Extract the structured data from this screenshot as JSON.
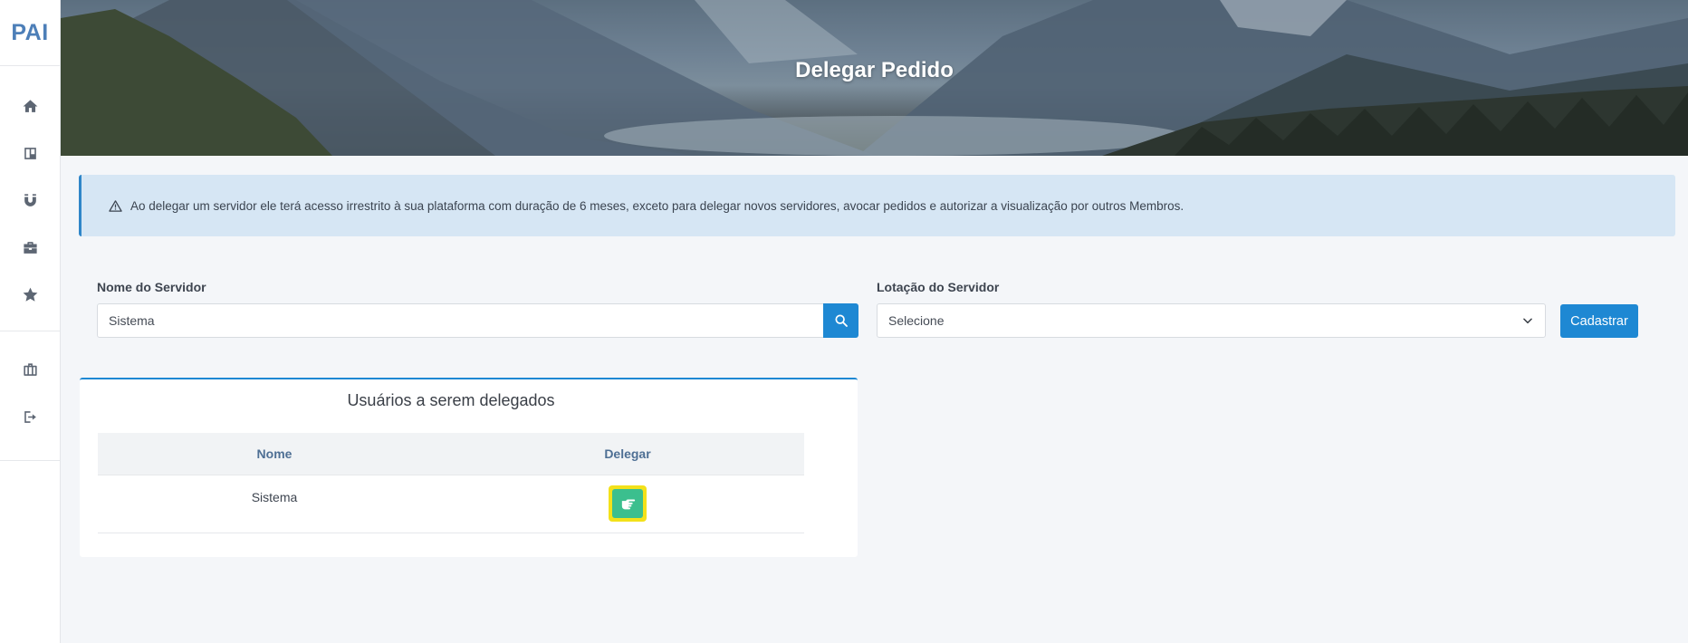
{
  "app": {
    "logo": "PAI"
  },
  "sidebar": {
    "items": [
      {
        "icon": "home-icon"
      },
      {
        "icon": "kanban-icon"
      },
      {
        "icon": "magnet-icon"
      },
      {
        "icon": "briefcase-icon"
      },
      {
        "icon": "star-icon"
      },
      {
        "icon": "suitcase-icon"
      },
      {
        "icon": "logout-icon"
      }
    ]
  },
  "hero": {
    "title": "Delegar Pedido"
  },
  "alert": {
    "icon": "warning-icon",
    "text": "Ao delegar um servidor ele terá acesso irrestrito à sua plataforma com duração de 6 meses, exceto para delegar novos servidores, avocar pedidos e autorizar a visualização por outros Membros."
  },
  "form": {
    "server_name": {
      "label": "Nome do Servidor",
      "value": "Sistema"
    },
    "server_location": {
      "label": "Lotação do Servidor",
      "value": "Selecione"
    },
    "submit_label": "Cadastrar"
  },
  "card": {
    "title": "Usuários a serem delegados",
    "columns": [
      "Nome",
      "Delegar"
    ],
    "rows": [
      {
        "name": "Sistema"
      }
    ]
  },
  "colors": {
    "primary": "#1e88d3",
    "delegate_button": "#3bbf8e",
    "highlight": "#f3e11a",
    "alert_bg": "#d6e6f4"
  }
}
